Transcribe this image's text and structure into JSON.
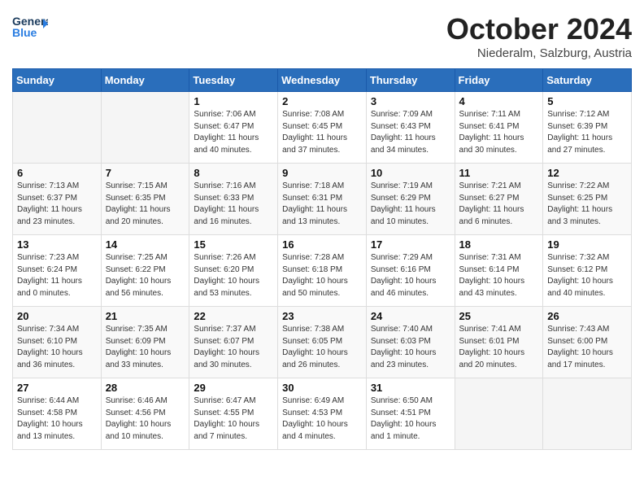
{
  "header": {
    "logo_line1": "General",
    "logo_line2": "Blue",
    "month": "October 2024",
    "location": "Niederalm, Salzburg, Austria"
  },
  "weekdays": [
    "Sunday",
    "Monday",
    "Tuesday",
    "Wednesday",
    "Thursday",
    "Friday",
    "Saturday"
  ],
  "weeks": [
    [
      {
        "day": "",
        "empty": true
      },
      {
        "day": "",
        "empty": true
      },
      {
        "day": "1",
        "sunrise": "7:06 AM",
        "sunset": "6:47 PM",
        "daylight": "11 hours and 40 minutes."
      },
      {
        "day": "2",
        "sunrise": "7:08 AM",
        "sunset": "6:45 PM",
        "daylight": "11 hours and 37 minutes."
      },
      {
        "day": "3",
        "sunrise": "7:09 AM",
        "sunset": "6:43 PM",
        "daylight": "11 hours and 34 minutes."
      },
      {
        "day": "4",
        "sunrise": "7:11 AM",
        "sunset": "6:41 PM",
        "daylight": "11 hours and 30 minutes."
      },
      {
        "day": "5",
        "sunrise": "7:12 AM",
        "sunset": "6:39 PM",
        "daylight": "11 hours and 27 minutes."
      }
    ],
    [
      {
        "day": "6",
        "sunrise": "7:13 AM",
        "sunset": "6:37 PM",
        "daylight": "11 hours and 23 minutes."
      },
      {
        "day": "7",
        "sunrise": "7:15 AM",
        "sunset": "6:35 PM",
        "daylight": "11 hours and 20 minutes."
      },
      {
        "day": "8",
        "sunrise": "7:16 AM",
        "sunset": "6:33 PM",
        "daylight": "11 hours and 16 minutes."
      },
      {
        "day": "9",
        "sunrise": "7:18 AM",
        "sunset": "6:31 PM",
        "daylight": "11 hours and 13 minutes."
      },
      {
        "day": "10",
        "sunrise": "7:19 AM",
        "sunset": "6:29 PM",
        "daylight": "11 hours and 10 minutes."
      },
      {
        "day": "11",
        "sunrise": "7:21 AM",
        "sunset": "6:27 PM",
        "daylight": "11 hours and 6 minutes."
      },
      {
        "day": "12",
        "sunrise": "7:22 AM",
        "sunset": "6:25 PM",
        "daylight": "11 hours and 3 minutes."
      }
    ],
    [
      {
        "day": "13",
        "sunrise": "7:23 AM",
        "sunset": "6:24 PM",
        "daylight": "11 hours and 0 minutes."
      },
      {
        "day": "14",
        "sunrise": "7:25 AM",
        "sunset": "6:22 PM",
        "daylight": "10 hours and 56 minutes."
      },
      {
        "day": "15",
        "sunrise": "7:26 AM",
        "sunset": "6:20 PM",
        "daylight": "10 hours and 53 minutes."
      },
      {
        "day": "16",
        "sunrise": "7:28 AM",
        "sunset": "6:18 PM",
        "daylight": "10 hours and 50 minutes."
      },
      {
        "day": "17",
        "sunrise": "7:29 AM",
        "sunset": "6:16 PM",
        "daylight": "10 hours and 46 minutes."
      },
      {
        "day": "18",
        "sunrise": "7:31 AM",
        "sunset": "6:14 PM",
        "daylight": "10 hours and 43 minutes."
      },
      {
        "day": "19",
        "sunrise": "7:32 AM",
        "sunset": "6:12 PM",
        "daylight": "10 hours and 40 minutes."
      }
    ],
    [
      {
        "day": "20",
        "sunrise": "7:34 AM",
        "sunset": "6:10 PM",
        "daylight": "10 hours and 36 minutes."
      },
      {
        "day": "21",
        "sunrise": "7:35 AM",
        "sunset": "6:09 PM",
        "daylight": "10 hours and 33 minutes."
      },
      {
        "day": "22",
        "sunrise": "7:37 AM",
        "sunset": "6:07 PM",
        "daylight": "10 hours and 30 minutes."
      },
      {
        "day": "23",
        "sunrise": "7:38 AM",
        "sunset": "6:05 PM",
        "daylight": "10 hours and 26 minutes."
      },
      {
        "day": "24",
        "sunrise": "7:40 AM",
        "sunset": "6:03 PM",
        "daylight": "10 hours and 23 minutes."
      },
      {
        "day": "25",
        "sunrise": "7:41 AM",
        "sunset": "6:01 PM",
        "daylight": "10 hours and 20 minutes."
      },
      {
        "day": "26",
        "sunrise": "7:43 AM",
        "sunset": "6:00 PM",
        "daylight": "10 hours and 17 minutes."
      }
    ],
    [
      {
        "day": "27",
        "sunrise": "6:44 AM",
        "sunset": "4:58 PM",
        "daylight": "10 hours and 13 minutes."
      },
      {
        "day": "28",
        "sunrise": "6:46 AM",
        "sunset": "4:56 PM",
        "daylight": "10 hours and 10 minutes."
      },
      {
        "day": "29",
        "sunrise": "6:47 AM",
        "sunset": "4:55 PM",
        "daylight": "10 hours and 7 minutes."
      },
      {
        "day": "30",
        "sunrise": "6:49 AM",
        "sunset": "4:53 PM",
        "daylight": "10 hours and 4 minutes."
      },
      {
        "day": "31",
        "sunrise": "6:50 AM",
        "sunset": "4:51 PM",
        "daylight": "10 hours and 1 minute."
      },
      {
        "day": "",
        "empty": true
      },
      {
        "day": "",
        "empty": true
      }
    ]
  ],
  "labels": {
    "sunrise_label": "Sunrise: ",
    "sunset_label": "Sunset: ",
    "daylight_label": "Daylight: "
  }
}
